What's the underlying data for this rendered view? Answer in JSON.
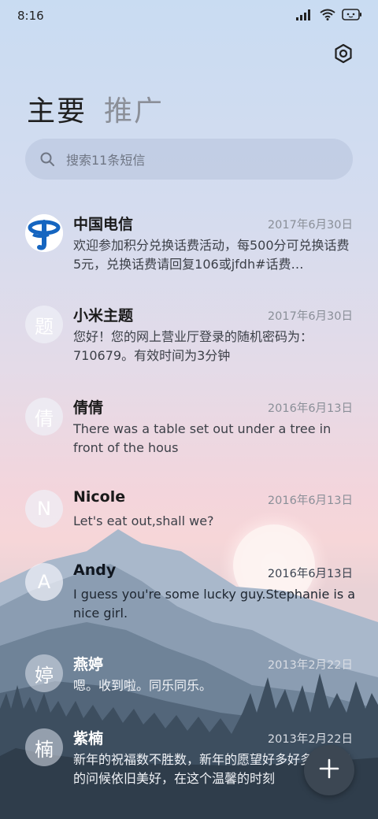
{
  "status_bar": {
    "time": "8:16"
  },
  "tabs": {
    "primary": "主要",
    "promo": "推广"
  },
  "search": {
    "placeholder": "搜索11条短信"
  },
  "messages": [
    {
      "name": "中国电信",
      "date": "2017年6月30日",
      "avatar": "",
      "preview": "欢迎参加积分兑换话费活动，每500分可兑换话费5元，兑换话费请回复106或jfdh#话费…"
    },
    {
      "name": "小米主题",
      "date": "2017年6月30日",
      "avatar": "题",
      "preview": "您好！您的网上营业厅登录的随机密码为：710679。有效时间为3分钟"
    },
    {
      "name": "倩倩",
      "date": "2016年6月13日",
      "avatar": "倩",
      "preview": "There was a table set out under a tree in front of the hous"
    },
    {
      "name": "Nicole",
      "date": "2016年6月13日",
      "avatar": "N",
      "preview": "Let's eat out,shall we?"
    },
    {
      "name": "Andy",
      "date": "2016年6月13日",
      "avatar": "A",
      "preview": "I guess you're some lucky guy.Stephanie is a nice girl."
    },
    {
      "name": "燕婷",
      "date": "2013年2月22日",
      "avatar": "婷",
      "preview": "嗯。收到啦。同乐同乐。"
    },
    {
      "name": "紫楠",
      "date": "2013年2月22日",
      "avatar": "楠",
      "preview": "新年的祝福数不胜数，新年的愿望好多好多，新年的问候依旧美好，在这个温馨的时刻"
    }
  ],
  "colors": {
    "fab": "#3c4753",
    "accent_text": "#1f1f1f"
  },
  "icons": {
    "settings": "settings-icon",
    "search": "search-icon",
    "compose": "plus-icon"
  }
}
